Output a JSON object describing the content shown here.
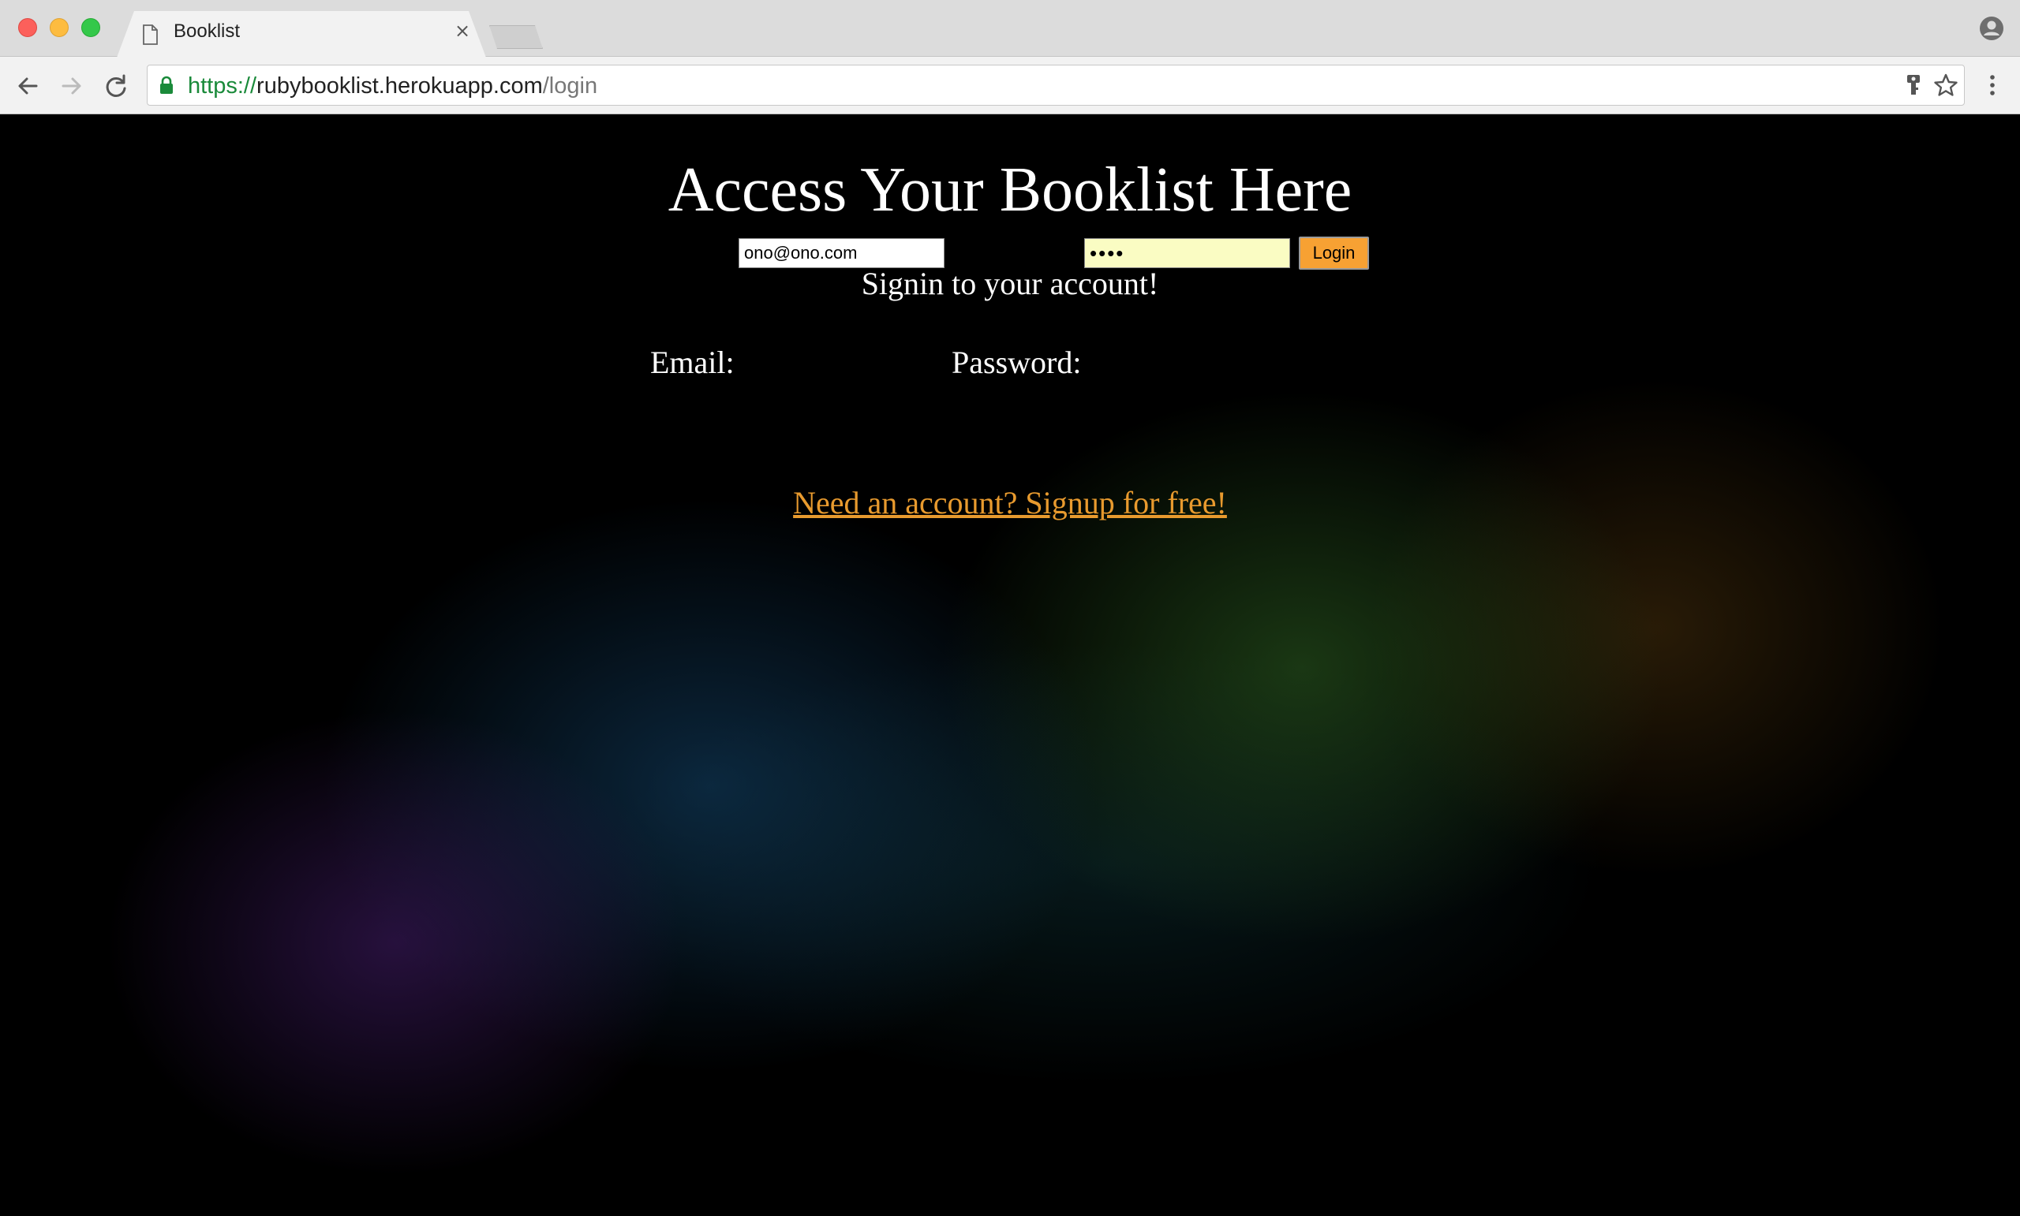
{
  "browser": {
    "tab_title": "Booklist",
    "url": {
      "scheme": "https://",
      "host": "rubybooklist.herokuapp.com",
      "path": "/login"
    },
    "icons": {
      "document": "document-icon",
      "close_tab": "close-icon",
      "back": "back-arrow-icon",
      "forward": "forward-arrow-icon",
      "reload": "reload-icon",
      "secure": "lock-icon",
      "password_key": "key-icon",
      "bookmark": "star-icon",
      "menu": "vertical-ellipsis-icon",
      "profile": "profile-icon"
    }
  },
  "page": {
    "title": "Access Your Booklist Here",
    "subtitle": "Signin to your account!",
    "form": {
      "email_label": "Email:",
      "email_value": "ono@ono.com",
      "password_label": "Password:",
      "password_value": "••••",
      "login_button": "Login"
    },
    "signup_link": "Need an account? Signup for free!"
  },
  "colors": {
    "background": "#000000",
    "button": "#f7a133",
    "link": "#e89a2e",
    "password_autofill_bg": "#fafcc3",
    "secure_green": "#1a8a3a"
  }
}
